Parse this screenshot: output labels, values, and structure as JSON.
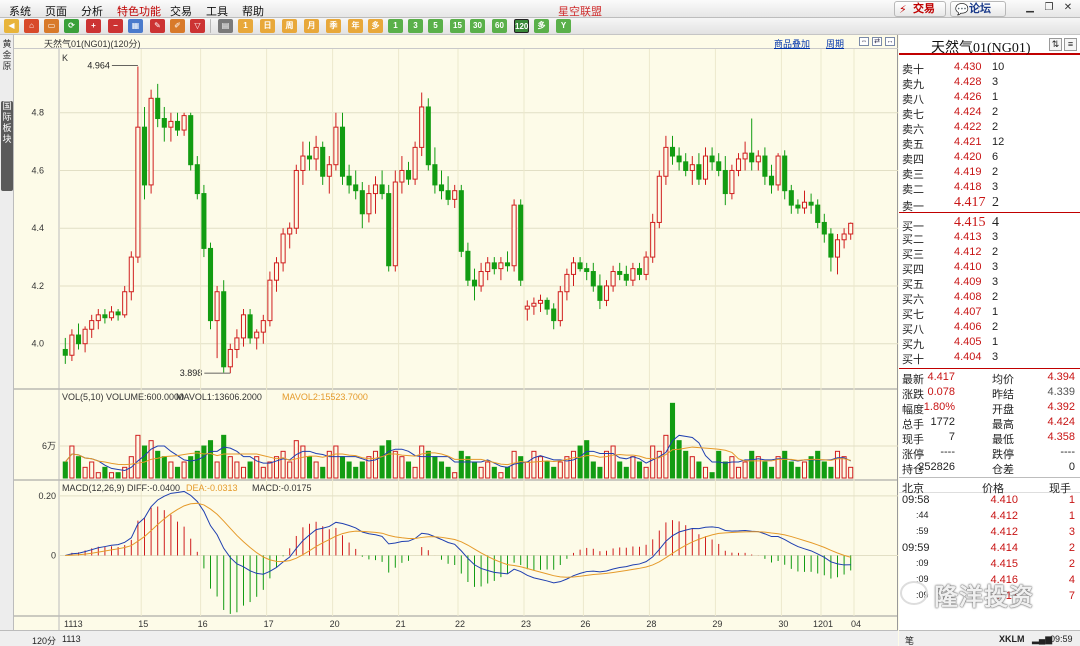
{
  "menubar": {
    "items": [
      "系统",
      "页面",
      "分析",
      "特色功能",
      "交易",
      "工具",
      "帮助"
    ],
    "app_title": "星空联盟",
    "trade_button": "交易",
    "forum_button": "论坛"
  },
  "leftstrip": {
    "tab1": "黄金原",
    "tab2": "国际板块"
  },
  "chart_header": {
    "instrument": "天然气01(NG01)(120分)",
    "overlay_link": "商品叠加",
    "period_link": "周期"
  },
  "status_left": {
    "period": "120分",
    "start_date": "1113"
  },
  "colors": {
    "up": "#d01e1e",
    "down": "#129c12",
    "ma1": "#1f3fb0",
    "ma2": "#e59a2a",
    "background": "#fdfbe8"
  },
  "chart_data": [
    {
      "type": "candlestick",
      "title": "K",
      "ylim": [
        3.85,
        5.0
      ],
      "yticks": [
        4.0,
        4.2,
        4.4,
        4.6,
        4.8
      ],
      "x_labels": [
        "1113",
        "15",
        "16",
        "17",
        "20",
        "21",
        "22",
        "23",
        "26",
        "28",
        "29",
        "30",
        "1201",
        "04"
      ],
      "annotations": [
        {
          "text": "4.964",
          "value": 4.964
        },
        {
          "text": "3.898",
          "value": 3.898
        }
      ],
      "ohlc": [
        [
          3.98,
          4.02,
          3.93,
          3.96
        ],
        [
          3.96,
          4.05,
          3.94,
          4.03
        ],
        [
          4.03,
          4.07,
          3.98,
          4.0
        ],
        [
          4.0,
          4.06,
          3.97,
          4.05
        ],
        [
          4.05,
          4.1,
          4.02,
          4.08
        ],
        [
          4.08,
          4.12,
          4.05,
          4.1
        ],
        [
          4.1,
          4.12,
          4.07,
          4.09
        ],
        [
          4.09,
          4.13,
          4.08,
          4.11
        ],
        [
          4.11,
          4.12,
          4.08,
          4.1
        ],
        [
          4.1,
          4.2,
          4.09,
          4.18
        ],
        [
          4.18,
          4.32,
          4.15,
          4.3
        ],
        [
          4.3,
          4.96,
          4.28,
          4.75
        ],
        [
          4.75,
          4.82,
          4.5,
          4.55
        ],
        [
          4.55,
          4.88,
          4.52,
          4.85
        ],
        [
          4.85,
          4.9,
          4.75,
          4.78
        ],
        [
          4.78,
          4.82,
          4.7,
          4.75
        ],
        [
          4.75,
          4.8,
          4.7,
          4.77
        ],
        [
          4.77,
          4.8,
          4.72,
          4.74
        ],
        [
          4.74,
          4.8,
          4.72,
          4.79
        ],
        [
          4.79,
          4.8,
          4.6,
          4.62
        ],
        [
          4.62,
          4.65,
          4.5,
          4.52
        ],
        [
          4.52,
          4.55,
          4.3,
          4.33
        ],
        [
          4.33,
          4.35,
          4.05,
          4.08
        ],
        [
          4.08,
          4.2,
          3.95,
          4.18
        ],
        [
          4.18,
          4.22,
          3.9,
          3.92
        ],
        [
          3.92,
          4.0,
          3.898,
          3.98
        ],
        [
          3.98,
          4.05,
          3.95,
          4.02
        ],
        [
          4.02,
          4.12,
          3.99,
          4.1
        ],
        [
          4.1,
          4.12,
          4.0,
          4.02
        ],
        [
          4.02,
          4.05,
          3.98,
          4.04
        ],
        [
          4.04,
          4.1,
          4.0,
          4.08
        ],
        [
          4.08,
          4.25,
          4.06,
          4.22
        ],
        [
          4.22,
          4.3,
          4.18,
          4.28
        ],
        [
          4.28,
          4.4,
          4.25,
          4.38
        ],
        [
          4.38,
          4.42,
          4.33,
          4.4
        ],
        [
          4.4,
          4.62,
          4.38,
          4.6
        ],
        [
          4.6,
          4.7,
          4.55,
          4.65
        ],
        [
          4.65,
          4.7,
          4.6,
          4.64
        ],
        [
          4.64,
          4.72,
          4.6,
          4.68
        ],
        [
          4.68,
          4.7,
          4.55,
          4.58
        ],
        [
          4.58,
          4.65,
          4.52,
          4.62
        ],
        [
          4.62,
          4.8,
          4.6,
          4.75
        ],
        [
          4.75,
          4.8,
          4.55,
          4.58
        ],
        [
          4.58,
          4.62,
          4.52,
          4.55
        ],
        [
          4.55,
          4.6,
          4.5,
          4.53
        ],
        [
          4.53,
          4.56,
          4.4,
          4.45
        ],
        [
          4.45,
          4.55,
          4.42,
          4.52
        ],
        [
          4.52,
          4.58,
          4.45,
          4.55
        ],
        [
          4.55,
          4.6,
          4.5,
          4.52
        ],
        [
          4.52,
          4.55,
          4.25,
          4.27
        ],
        [
          4.27,
          4.6,
          4.25,
          4.56
        ],
        [
          4.56,
          4.65,
          4.52,
          4.6
        ],
        [
          4.6,
          4.63,
          4.55,
          4.57
        ],
        [
          4.57,
          4.7,
          4.55,
          4.68
        ],
        [
          4.68,
          4.87,
          4.65,
          4.82
        ],
        [
          4.82,
          4.85,
          4.6,
          4.62
        ],
        [
          4.62,
          4.68,
          4.52,
          4.55
        ],
        [
          4.55,
          4.6,
          4.5,
          4.53
        ],
        [
          4.53,
          4.58,
          4.48,
          4.5
        ],
        [
          4.5,
          4.55,
          4.47,
          4.53
        ],
        [
          4.53,
          4.55,
          4.3,
          4.32
        ],
        [
          4.32,
          4.35,
          4.2,
          4.22
        ],
        [
          4.22,
          4.26,
          4.15,
          4.2
        ],
        [
          4.2,
          4.28,
          4.18,
          4.25
        ],
        [
          4.25,
          4.3,
          4.22,
          4.28
        ],
        [
          4.28,
          4.3,
          4.24,
          4.26
        ],
        [
          4.26,
          4.3,
          4.22,
          4.28
        ],
        [
          4.28,
          4.32,
          4.25,
          4.27
        ],
        [
          4.27,
          4.5,
          4.25,
          4.48
        ],
        [
          4.48,
          4.5,
          4.2,
          4.22
        ],
        [
          4.12,
          4.15,
          4.08,
          4.13
        ],
        [
          4.13,
          4.16,
          4.1,
          4.14
        ],
        [
          4.14,
          4.17,
          4.11,
          4.15
        ],
        [
          4.15,
          4.16,
          4.1,
          4.12
        ],
        [
          4.12,
          4.14,
          4.05,
          4.08
        ],
        [
          4.08,
          4.2,
          4.06,
          4.18
        ],
        [
          4.18,
          4.26,
          4.15,
          4.24
        ],
        [
          4.24,
          4.3,
          4.2,
          4.28
        ],
        [
          4.28,
          4.3,
          4.25,
          4.26
        ],
        [
          4.26,
          4.28,
          4.22,
          4.25
        ],
        [
          4.25,
          4.28,
          4.18,
          4.2
        ],
        [
          4.2,
          4.24,
          4.12,
          4.15
        ],
        [
          4.15,
          4.22,
          4.13,
          4.2
        ],
        [
          4.2,
          4.27,
          4.18,
          4.25
        ],
        [
          4.25,
          4.28,
          4.22,
          4.24
        ],
        [
          4.24,
          4.27,
          4.2,
          4.22
        ],
        [
          4.22,
          4.28,
          4.2,
          4.26
        ],
        [
          4.26,
          4.28,
          4.22,
          4.24
        ],
        [
          4.24,
          4.32,
          4.22,
          4.3
        ],
        [
          4.3,
          4.45,
          4.28,
          4.42
        ],
        [
          4.42,
          4.6,
          4.4,
          4.58
        ],
        [
          4.58,
          4.72,
          4.55,
          4.68
        ],
        [
          4.68,
          4.72,
          4.62,
          4.65
        ],
        [
          4.65,
          4.68,
          4.6,
          4.63
        ],
        [
          4.63,
          4.66,
          4.58,
          4.6
        ],
        [
          4.6,
          4.65,
          4.55,
          4.62
        ],
        [
          4.62,
          4.66,
          4.55,
          4.57
        ],
        [
          4.57,
          4.68,
          4.55,
          4.65
        ],
        [
          4.65,
          4.68,
          4.6,
          4.63
        ],
        [
          4.63,
          4.66,
          4.58,
          4.6
        ],
        [
          4.6,
          4.65,
          4.48,
          4.52
        ],
        [
          4.52,
          4.62,
          4.5,
          4.6
        ],
        [
          4.6,
          4.66,
          4.58,
          4.64
        ],
        [
          4.64,
          4.7,
          4.6,
          4.66
        ],
        [
          4.66,
          4.78,
          4.6,
          4.63
        ],
        [
          4.63,
          4.67,
          4.6,
          4.65
        ],
        [
          4.65,
          4.68,
          4.55,
          4.58
        ],
        [
          4.58,
          4.62,
          4.52,
          4.55
        ],
        [
          4.55,
          4.66,
          4.53,
          4.65
        ],
        [
          4.65,
          4.67,
          4.5,
          4.53
        ],
        [
          4.53,
          4.55,
          4.45,
          4.48
        ],
        [
          4.48,
          4.5,
          4.45,
          4.47
        ],
        [
          4.47,
          4.53,
          4.45,
          4.49
        ],
        [
          4.49,
          4.52,
          4.45,
          4.48
        ],
        [
          4.48,
          4.5,
          4.4,
          4.42
        ],
        [
          4.42,
          4.45,
          4.35,
          4.38
        ],
        [
          4.38,
          4.4,
          4.25,
          4.3
        ],
        [
          4.3,
          4.38,
          4.24,
          4.36
        ],
        [
          4.36,
          4.4,
          4.33,
          4.38
        ],
        [
          4.38,
          4.42,
          4.36,
          4.417
        ]
      ]
    },
    {
      "type": "bar",
      "title": "VOL(5,10)",
      "labels": [
        {
          "text": "VOL(5,10) VOLUME:600.0000"
        },
        {
          "text": "MAVOL1:13606.2000"
        },
        {
          "text": "MAVOL2:15523.7000"
        }
      ],
      "ytick": "6万",
      "values": [
        3,
        6,
        4,
        2,
        3,
        1,
        2,
        1,
        1,
        2,
        4,
        8,
        6,
        7,
        5,
        4,
        3,
        2,
        3,
        4,
        5,
        6,
        7,
        3,
        8,
        4,
        3,
        2,
        3,
        4,
        2,
        3,
        4,
        5,
        3,
        7,
        6,
        4,
        3,
        2,
        5,
        6,
        4,
        3,
        2,
        3,
        4,
        5,
        6,
        7,
        5,
        4,
        3,
        2,
        6,
        5,
        4,
        3,
        2,
        1,
        5,
        4,
        3,
        2,
        3,
        2,
        1,
        2,
        5,
        4,
        3,
        5,
        4,
        3,
        2,
        3,
        4,
        5,
        6,
        7,
        3,
        2,
        5,
        6,
        3,
        2,
        4,
        3,
        2,
        6,
        5,
        8,
        14,
        7,
        5,
        4,
        3,
        2,
        1,
        5,
        3,
        4,
        2,
        3,
        5,
        4,
        3,
        2,
        4,
        5,
        3,
        2,
        3,
        4,
        5,
        3,
        2,
        5,
        4,
        2
      ]
    },
    {
      "type": "bar",
      "title": "MACD(12,26,9)",
      "labels": [
        {
          "text": "MACD(12,26,9) DIFF:-0.0400"
        },
        {
          "text": "DEA:-0.0313"
        },
        {
          "text": "MACD:-0.0175"
        }
      ],
      "yticks": [
        {
          "text": "0.20",
          "value": 0.2
        },
        {
          "text": "0",
          "value": 0
        }
      ],
      "ylim": [
        -0.2,
        0.25
      ]
    }
  ],
  "right_panel": {
    "title": "天然气01(NG01)",
    "asks": [
      {
        "label": "卖十",
        "price": "4.430",
        "vol": "10"
      },
      {
        "label": "卖九",
        "price": "4.428",
        "vol": "3"
      },
      {
        "label": "卖八",
        "price": "4.426",
        "vol": "1"
      },
      {
        "label": "卖七",
        "price": "4.424",
        "vol": "2"
      },
      {
        "label": "卖六",
        "price": "4.422",
        "vol": "2"
      },
      {
        "label": "卖五",
        "price": "4.421",
        "vol": "12"
      },
      {
        "label": "卖四",
        "price": "4.420",
        "vol": "6"
      },
      {
        "label": "卖三",
        "price": "4.419",
        "vol": "2"
      },
      {
        "label": "卖二",
        "price": "4.418",
        "vol": "3"
      },
      {
        "label": "卖一",
        "price": "4.417",
        "vol": "2"
      }
    ],
    "bids": [
      {
        "label": "买一",
        "price": "4.415",
        "vol": "4"
      },
      {
        "label": "买二",
        "price": "4.413",
        "vol": "3"
      },
      {
        "label": "买三",
        "price": "4.412",
        "vol": "2"
      },
      {
        "label": "买四",
        "price": "4.410",
        "vol": "3"
      },
      {
        "label": "买五",
        "price": "4.409",
        "vol": "3"
      },
      {
        "label": "买六",
        "price": "4.408",
        "vol": "2"
      },
      {
        "label": "买七",
        "price": "4.407",
        "vol": "1"
      },
      {
        "label": "买八",
        "price": "4.406",
        "vol": "2"
      },
      {
        "label": "买九",
        "price": "4.405",
        "vol": "1"
      },
      {
        "label": "买十",
        "price": "4.404",
        "vol": "3"
      }
    ],
    "quote": [
      {
        "k1": "最新",
        "v1": "4.417",
        "k2": "均价",
        "v2": "4.394",
        "c1": "#c81414",
        "c2": "#c81414"
      },
      {
        "k1": "涨跌",
        "v1": "0.078",
        "k2": "昨结",
        "v2": "4.339",
        "c1": "#c81414",
        "c2": "#555555"
      },
      {
        "k1": "幅度",
        "v1": "1.80%",
        "k2": "开盘",
        "v2": "4.392",
        "c1": "#c81414",
        "c2": "#c81414"
      },
      {
        "k1": "总手",
        "v1": "1772",
        "k2": "最高",
        "v2": "4.424",
        "c1": "#222222",
        "c2": "#c81414"
      },
      {
        "k1": "现手",
        "v1": "7",
        "k2": "最低",
        "v2": "4.358",
        "c1": "#222222",
        "c2": "#c81414"
      },
      {
        "k1": "涨停",
        "v1": "----",
        "k2": "跌停",
        "v2": "----",
        "c1": "#222222",
        "c2": "#222222"
      },
      {
        "k1": "持仓",
        "v1": "252826",
        "k2": "仓差",
        "v2": "0",
        "c1": "#222222",
        "c2": "#222222"
      }
    ],
    "ticks_header": {
      "c1": "北京",
      "c2": "价格",
      "c3": "现手"
    },
    "ticks": [
      {
        "time": "09:58",
        "price": "4.410",
        "vol": "1"
      },
      {
        "time": ":44",
        "price": "4.412",
        "vol": "1"
      },
      {
        "time": ":59",
        "price": "4.412",
        "vol": "3"
      },
      {
        "time": "09:59",
        "price": "4.414",
        "vol": "2"
      },
      {
        "time": ":09",
        "price": "4.415",
        "vol": "2"
      },
      {
        "time": ":09",
        "price": "4.416",
        "vol": "4"
      },
      {
        "time": ":09",
        "price": "4.417",
        "vol": "7"
      }
    ],
    "watermark": "隆洋投资",
    "status_tab": "笔",
    "status_brand": "XKLM",
    "status_time": "09:59"
  }
}
